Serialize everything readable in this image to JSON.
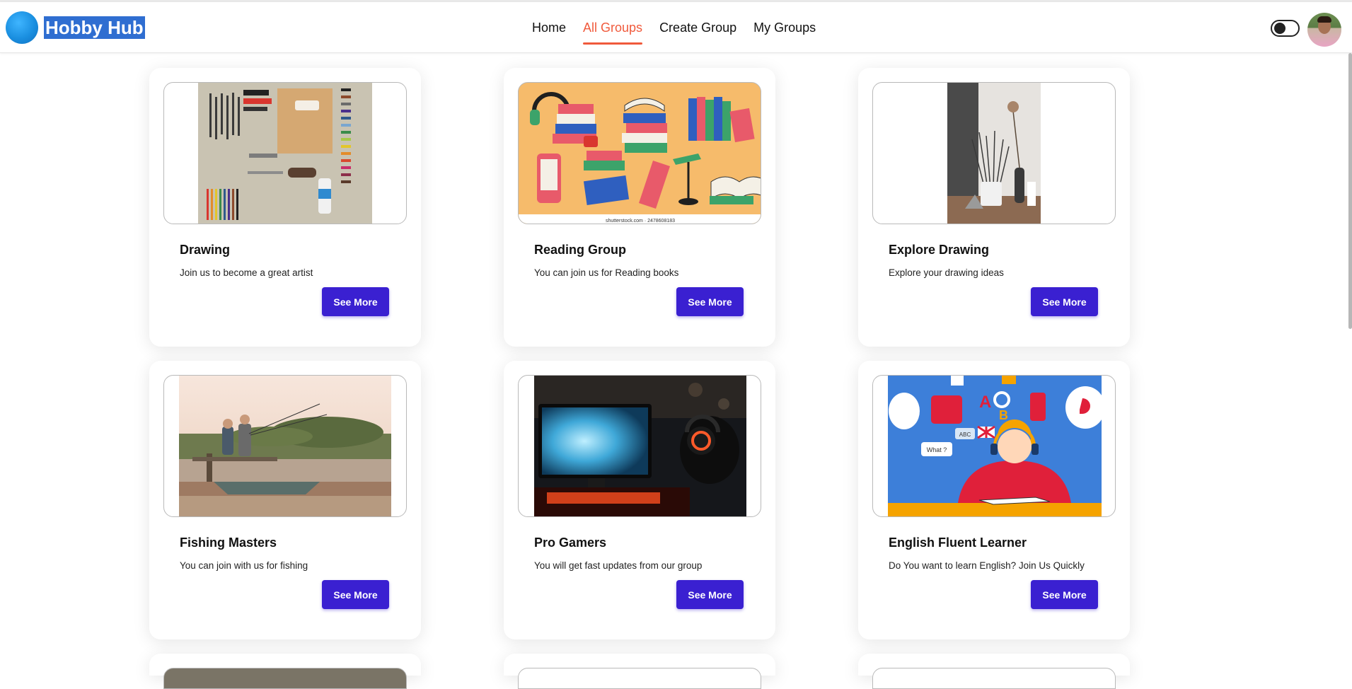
{
  "brand": {
    "name": "Hobby Hub"
  },
  "nav": {
    "items": [
      {
        "label": "Home",
        "active": false
      },
      {
        "label": "All Groups",
        "active": true
      },
      {
        "label": "Create Group",
        "active": false
      },
      {
        "label": "My Groups",
        "active": false
      }
    ],
    "active_color": "#f05a3c"
  },
  "controls": {
    "theme_toggle_icon": "toggle-switch",
    "avatar_icon": "user-avatar"
  },
  "colors": {
    "primary_button": "#3a20d1",
    "brand_highlight": "#2f6ed1"
  },
  "groups": [
    {
      "title": "Drawing",
      "description": "Join us to become a great artist",
      "button": "See More",
      "image": "art-supplies-photo"
    },
    {
      "title": "Reading Group",
      "description": "You can join us for Reading books",
      "button": "See More",
      "image": "books-illustration",
      "image_caption": "shutterstock.com · 2478608183"
    },
    {
      "title": "Explore Drawing",
      "description": "Explore your drawing ideas",
      "button": "See More",
      "image": "paint-brushes-photo"
    },
    {
      "title": "Fishing Masters",
      "description": "You can join with us for fishing",
      "button": "See More",
      "image": "fishing-photo"
    },
    {
      "title": "Pro Gamers",
      "description": "You will get fast updates from our group",
      "button": "See More",
      "image": "gamer-photo"
    },
    {
      "title": "English Fluent Learner",
      "description": "Do You want to learn English? Join Us Quickly",
      "button": "See More",
      "image": "english-learning-illustration",
      "image_labels": [
        "What ?",
        "ABC",
        "A",
        "B"
      ]
    }
  ]
}
